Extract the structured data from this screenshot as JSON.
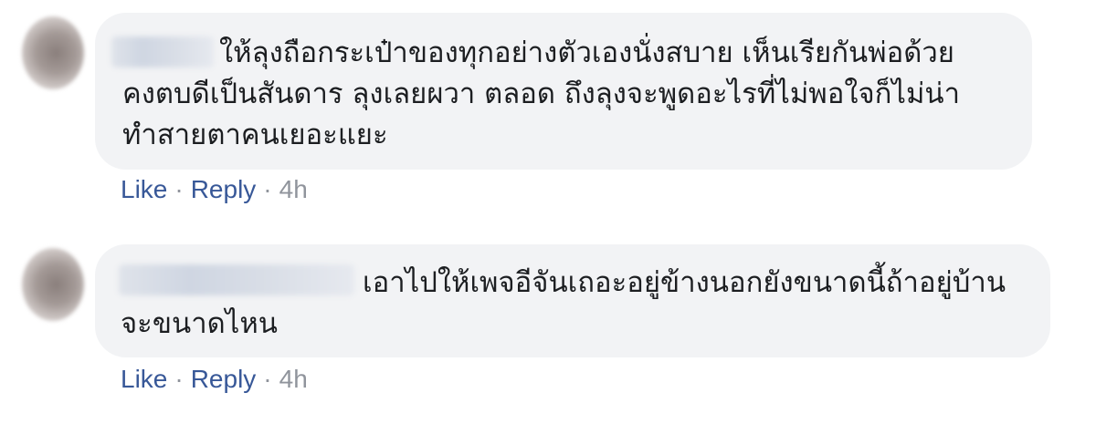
{
  "comments": [
    {
      "text": "ให้ลุงถือกระเป๋าของทุกอย่างตัวเองนั่งสบาย เห็นเรียกันพ่อด้วย คงตบดีเป็นสันดาร ลุงเลยผวา ตลอด ถึงลุงจะพูดอะไรที่ไม่พอใจก็ไม่น่าทำสายตาคนเยอะแยะ",
      "like_label": "Like",
      "reply_label": "Reply",
      "separator": "·",
      "time": "4h"
    },
    {
      "text": "เอาไปให้เพจอีจันเถอะอยู่ข้างนอกยังขนาดนี้ถ้าอยู่บ้านจะขนาดไหน",
      "like_label": "Like",
      "reply_label": "Reply",
      "separator": "·",
      "time": "4h"
    }
  ]
}
